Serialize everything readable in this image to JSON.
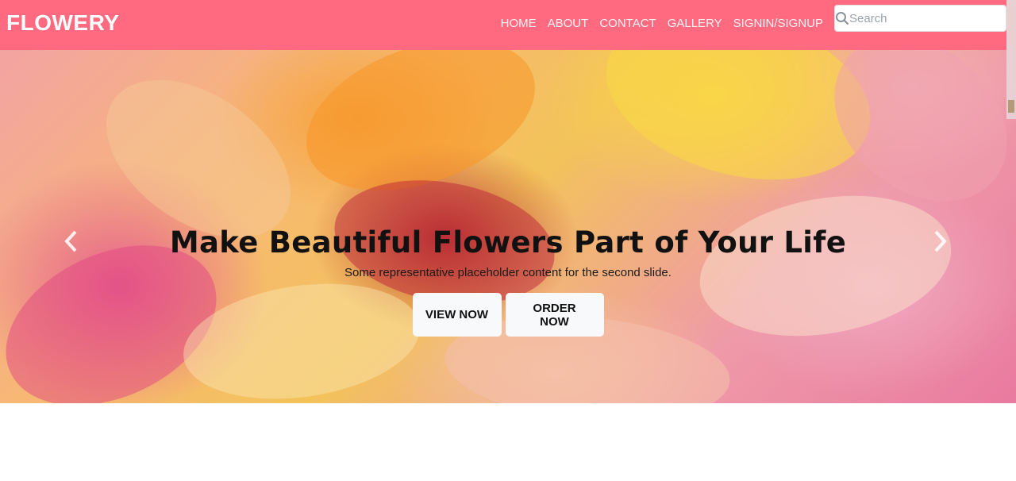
{
  "brand": "FLOWERY",
  "nav": {
    "items": [
      {
        "label": "HOME"
      },
      {
        "label": "ABOUT"
      },
      {
        "label": "CONTACT"
      },
      {
        "label": "GALLERY"
      },
      {
        "label": "SIGNIN/SIGNUP"
      }
    ]
  },
  "search": {
    "placeholder": "Search",
    "icon": "search-icon"
  },
  "carousel": {
    "title": "Make Beautiful Flowers Part of Your Life",
    "text": "Some representative placeholder content for the second slide.",
    "buttons": {
      "view": "VIEW NOW",
      "order": "ORDER NOW"
    },
    "prev_icon": "chevron-left-icon",
    "next_icon": "chevron-right-icon"
  },
  "colors": {
    "navbar": "#ff6a80",
    "button_bg": "#f8f9fa"
  }
}
